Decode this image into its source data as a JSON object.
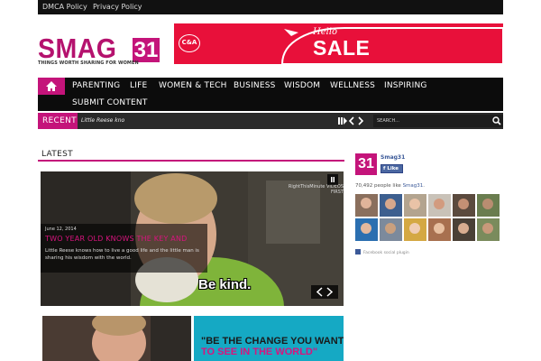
{
  "top_links": [
    "DMCA Policy",
    "Privacy Policy"
  ],
  "logo": {
    "text": "SMAG",
    "number": "31",
    "tagline": "THINGS WORTH SHARING FOR WOMEN"
  },
  "ad": {
    "brand": "C&A",
    "greeting": "Hello",
    "headline": "SALE"
  },
  "nav": {
    "home_icon": "home-icon",
    "items": [
      "PARENTING",
      "LIFE",
      "WOMEN & TECH",
      "BUSINESS",
      "WISDOM",
      "WELLNESS",
      "INSPIRING"
    ],
    "items_row2": [
      "SUBMIT CONTENT"
    ]
  },
  "ticker": {
    "label": "RECENT",
    "text": "Little Reese kno",
    "search_placeholder": "SEARCH..."
  },
  "latest": {
    "heading": "LATEST",
    "feature": {
      "date": "June 12, 2014",
      "title": "TWO YEAR OLD KNOWS THE KEY AND",
      "excerpt": "Little Reese knows how to live a good life and the little man is sharing his wisdom with the world.",
      "caption": "Be kind.",
      "watermark": "RightThisMinute VIDEOS FIRST"
    },
    "thumb2_quote": {
      "line1": "\"BE THE CHANGE YOU WANT",
      "line2": "TO SEE IN THE WORLD\""
    }
  },
  "facebook": {
    "page_name": "Smag31",
    "like_label": "Like",
    "count_text": "70,492 people like ",
    "count_page": "Smag31",
    "count_end": ".",
    "plugin_label": "Facebook social plugin"
  },
  "colors": {
    "brand": "#c4147a",
    "nav_bg": "#0c0c0c",
    "ad_bg": "#e8103a",
    "facebook": "#3b5998"
  }
}
